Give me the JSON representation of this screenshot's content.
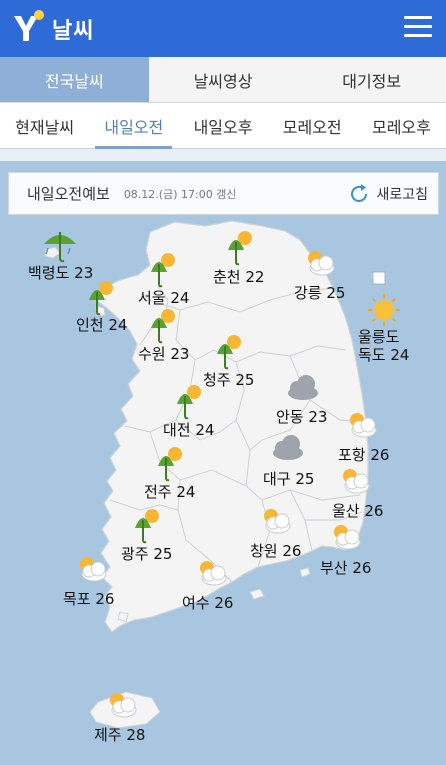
{
  "app": {
    "title": "날씨",
    "logo": "y-logo-icon"
  },
  "tabs_primary": [
    {
      "label": "전국날씨",
      "active": true
    },
    {
      "label": "날씨영상",
      "active": false
    },
    {
      "label": "대기정보",
      "active": false
    }
  ],
  "tabs_secondary": [
    {
      "label": "현재날씨",
      "active": false
    },
    {
      "label": "내일오전",
      "active": true
    },
    {
      "label": "내일오후",
      "active": false
    },
    {
      "label": "모레오전",
      "active": false
    },
    {
      "label": "모레오후",
      "active": false
    }
  ],
  "forecast_bar": {
    "title": "내일오전예보",
    "updated": "08.12.(금) 17:00 갱신",
    "refresh_label": "새로고침"
  },
  "cities": [
    {
      "name": "백령도",
      "temp": "23",
      "weather": "umbrella-icon"
    },
    {
      "name": "서울",
      "temp": "24",
      "weather": "rain-sun-icon"
    },
    {
      "name": "춘천",
      "temp": "22",
      "weather": "rain-sun-icon"
    },
    {
      "name": "강릉",
      "temp": "25",
      "weather": "partly-cloudy-icon"
    },
    {
      "name": "인천",
      "temp": "24",
      "weather": "rain-sun-icon"
    },
    {
      "name": "수원",
      "temp": "23",
      "weather": "rain-sun-icon"
    },
    {
      "name": "울릉도\n독도",
      "temp": "24",
      "weather": "sunny-icon"
    },
    {
      "name": "청주",
      "temp": "25",
      "weather": "rain-sun-icon"
    },
    {
      "name": "안동",
      "temp": "23",
      "weather": "cloudy-icon"
    },
    {
      "name": "대전",
      "temp": "24",
      "weather": "rain-sun-icon"
    },
    {
      "name": "포항",
      "temp": "26",
      "weather": "partly-cloudy-icon"
    },
    {
      "name": "대구",
      "temp": "25",
      "weather": "cloudy-icon"
    },
    {
      "name": "전주",
      "temp": "24",
      "weather": "rain-sun-icon"
    },
    {
      "name": "울산",
      "temp": "26",
      "weather": "partly-cloudy-icon"
    },
    {
      "name": "광주",
      "temp": "25",
      "weather": "rain-sun-icon"
    },
    {
      "name": "창원",
      "temp": "26",
      "weather": "partly-cloudy-icon"
    },
    {
      "name": "부산",
      "temp": "26",
      "weather": "partly-cloudy-icon"
    },
    {
      "name": "목포",
      "temp": "26",
      "weather": "partly-cloudy-icon"
    },
    {
      "name": "여수",
      "temp": "26",
      "weather": "partly-cloudy-icon"
    },
    {
      "name": "제주",
      "temp": "28",
      "weather": "partly-cloudy-icon"
    }
  ],
  "colors": {
    "brand": "#2f6bd6",
    "sea": "#a9c6e0",
    "land": "#f4f4f4",
    "accent": "#5580b3"
  }
}
